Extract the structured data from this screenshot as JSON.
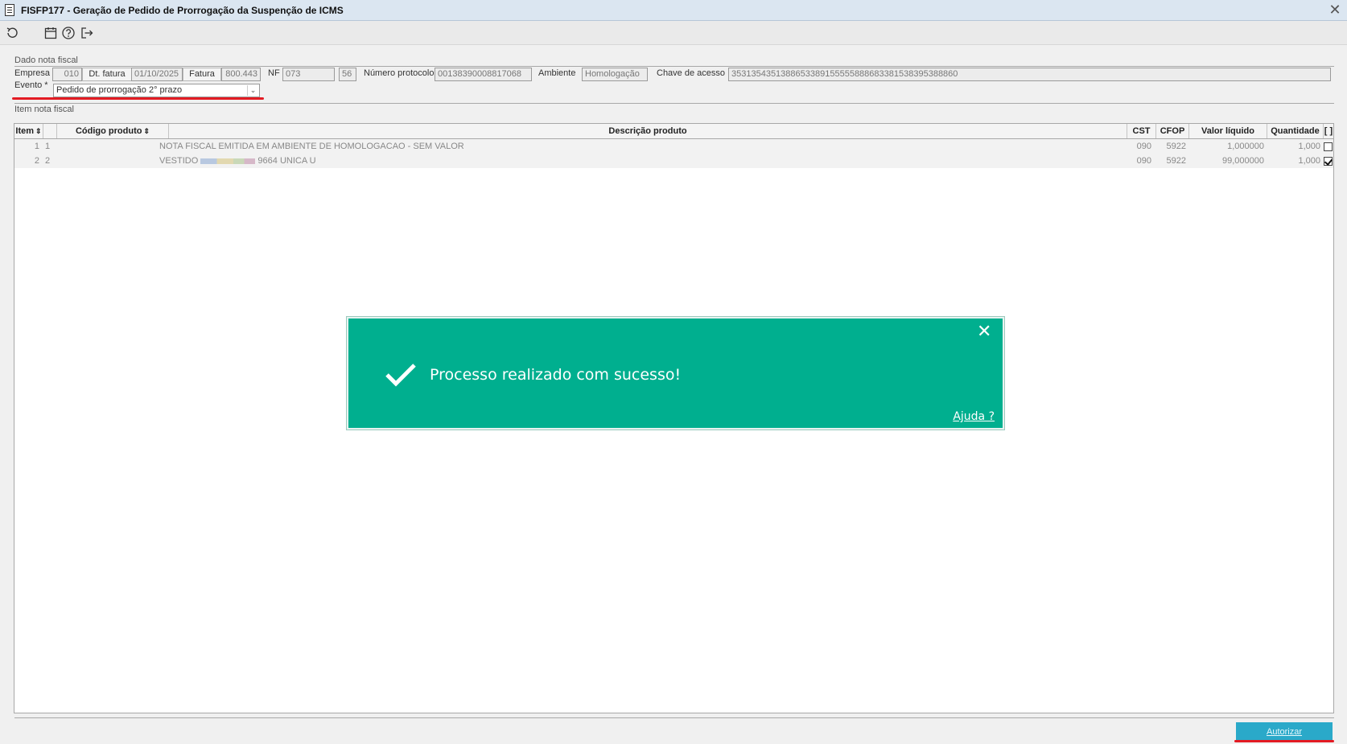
{
  "window": {
    "title": "FISFP177 - Geração de Pedido de Prorrogação da Suspenção de ICMS",
    "close_glyph": "✕"
  },
  "toolbar": {
    "buttons": [
      "refresh-icon",
      "calendar-icon",
      "help-icon",
      "exit-icon"
    ]
  },
  "header": {
    "section_title": "Dado nota fiscal",
    "empresa_label": "Empresa",
    "empresa_value": "010",
    "dt_fatura_label": "Dt. fatura",
    "dt_fatura_value": "01/10/2025",
    "fatura_label": "Fatura",
    "fatura_value": "800.443",
    "nf_label": "NF",
    "nf_value": "073",
    "serie_value": "56",
    "protocolo_label": "Número protocolo",
    "protocolo_value": "00138390008817068",
    "ambiente_label": "Ambiente",
    "ambiente_value": "Homologação",
    "chave_label": "Chave de acesso",
    "chave_value": "3531354351388653389155555888683381538395388860",
    "evento_label": "Evento *",
    "evento_value": "Pedido de prorrogação 2° prazo",
    "evento_arrow": "⌄"
  },
  "items": {
    "section_title": "Item nota fiscal",
    "columns": {
      "item": "Item",
      "codigo": "Código produto",
      "descricao": "Descrição produto",
      "cst": "CST",
      "cfop": "CFOP",
      "valor": "Valor líquido",
      "quantidade": "Quantidade",
      "select": "[ ]"
    },
    "sort_glyph": "⇕",
    "rows": [
      {
        "item": "1",
        "codigo": "1",
        "descricao": "NOTA FISCAL EMITIDA EM AMBIENTE DE HOMOLOGACAO - SEM VALOR",
        "descricao_suffix": "",
        "cst": "090",
        "cfop": "5922",
        "valor": "1,000000",
        "quantidade": "1,000",
        "checked": false
      },
      {
        "item": "2",
        "codigo": "2",
        "descricao": "VESTIDO",
        "descricao_suffix": "9664 UNICA U",
        "cst": "090",
        "cfop": "5922",
        "valor": "99,000000",
        "quantidade": "1,000",
        "checked": true
      }
    ]
  },
  "toast": {
    "message": "Processo realizado com sucesso!",
    "help": "Ajuda ?",
    "close_glyph": "✕",
    "color": "#00af8f"
  },
  "footer": {
    "autorizar_label": "Autorizar"
  },
  "colors": {
    "accent_red": "#e31b23",
    "button_blue": "#2aa9c9"
  }
}
